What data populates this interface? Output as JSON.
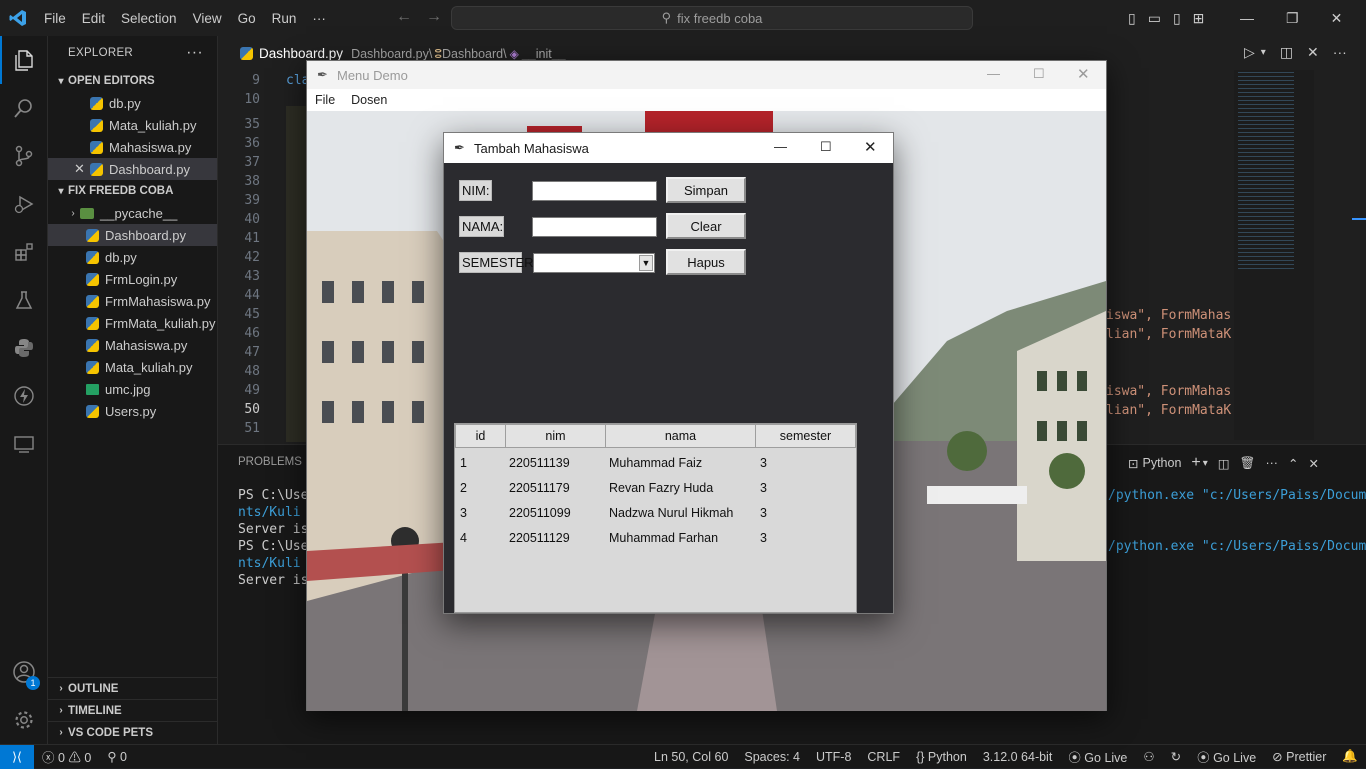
{
  "vscode": {
    "menu": [
      "File",
      "Edit",
      "Selection",
      "View",
      "Go",
      "Run",
      "···"
    ],
    "search": "fix freedb coba",
    "explorer_title": "EXPLORER",
    "open_editors_title": "OPEN EDITORS",
    "open_editors": [
      "db.py",
      "Mata_kuliah.py",
      "Mahasiswa.py",
      "Dashboard.py"
    ],
    "project_title": "FIX FREEDB COBA",
    "project_files": [
      "__pycache__",
      "Dashboard.py",
      "db.py",
      "FrmLogin.py",
      "FrmMahasiswa.py",
      "FrmMata_kuliah.py",
      "Mahasiswa.py",
      "Mata_kuliah.py",
      "umc.jpg",
      "Users.py"
    ],
    "outline": "OUTLINE",
    "timeline": "TIMELINE",
    "vscode_pets": "VS CODE PETS",
    "tab_label": "Dashboard.py",
    "breadcrumb": [
      "Dashboard.py",
      "Dashboard",
      "__init__"
    ],
    "line_numbers": [
      "9",
      "10",
      "35",
      "36",
      "37",
      "38",
      "39",
      "40",
      "41",
      "42",
      "43",
      "44",
      "45",
      "46",
      "47",
      "48",
      "49",
      "50",
      "51"
    ],
    "code_first": "cla",
    "code_right": [
      "iswa\", FormMahas",
      "lian\", FormMataK",
      "iswa\", FormMahas",
      "lian\", FormMataK"
    ],
    "panel_tab": "PROBLEMS",
    "terminal_kind": "Python",
    "terminal_left": [
      "PS C:\\User",
      "nts/Kuli a",
      "Server is",
      "PS C:\\User",
      "nts/Kuli a",
      "Server is"
    ],
    "terminal_right": [
      "/python.exe \"c:/Users/Paiss/Docume",
      "/python.exe \"c:/Users/Paiss/Docume"
    ],
    "status": {
      "errors": "0",
      "warnings": "0",
      "ports": "0",
      "position": "Ln 50, Col 60",
      "spaces": "Spaces: 4",
      "encoding": "UTF-8",
      "eol": "CRLF",
      "language": "Python",
      "interpreter": "3.12.0 64-bit",
      "golive": "Go Live",
      "golive2": "Go Live",
      "prettier": "Prettier"
    },
    "accounts_badge": "1"
  },
  "menu_demo": {
    "title": "Menu Demo",
    "menubar": [
      "File",
      "Dosen"
    ]
  },
  "dialog": {
    "title": "Tambah Mahasiswa",
    "labels": {
      "nim": "NIM:",
      "nama": "NAMA:",
      "semester": "SEMESTER:"
    },
    "values": {
      "nim": "",
      "nama": "",
      "semester": ""
    },
    "buttons": {
      "simpan": "Simpan",
      "clear": "Clear",
      "hapus": "Hapus"
    },
    "table": {
      "columns": [
        "id",
        "nim",
        "nama",
        "semester"
      ],
      "rows": [
        [
          "1",
          "220511139",
          "Muhammad Faiz",
          "3"
        ],
        [
          "2",
          "220511179",
          "Revan Fazry Huda",
          "3"
        ],
        [
          "3",
          "220511099",
          "Nadzwa Nurul Hikmah",
          "3"
        ],
        [
          "4",
          "220511129",
          "Muhammad Farhan",
          "3"
        ]
      ]
    }
  }
}
